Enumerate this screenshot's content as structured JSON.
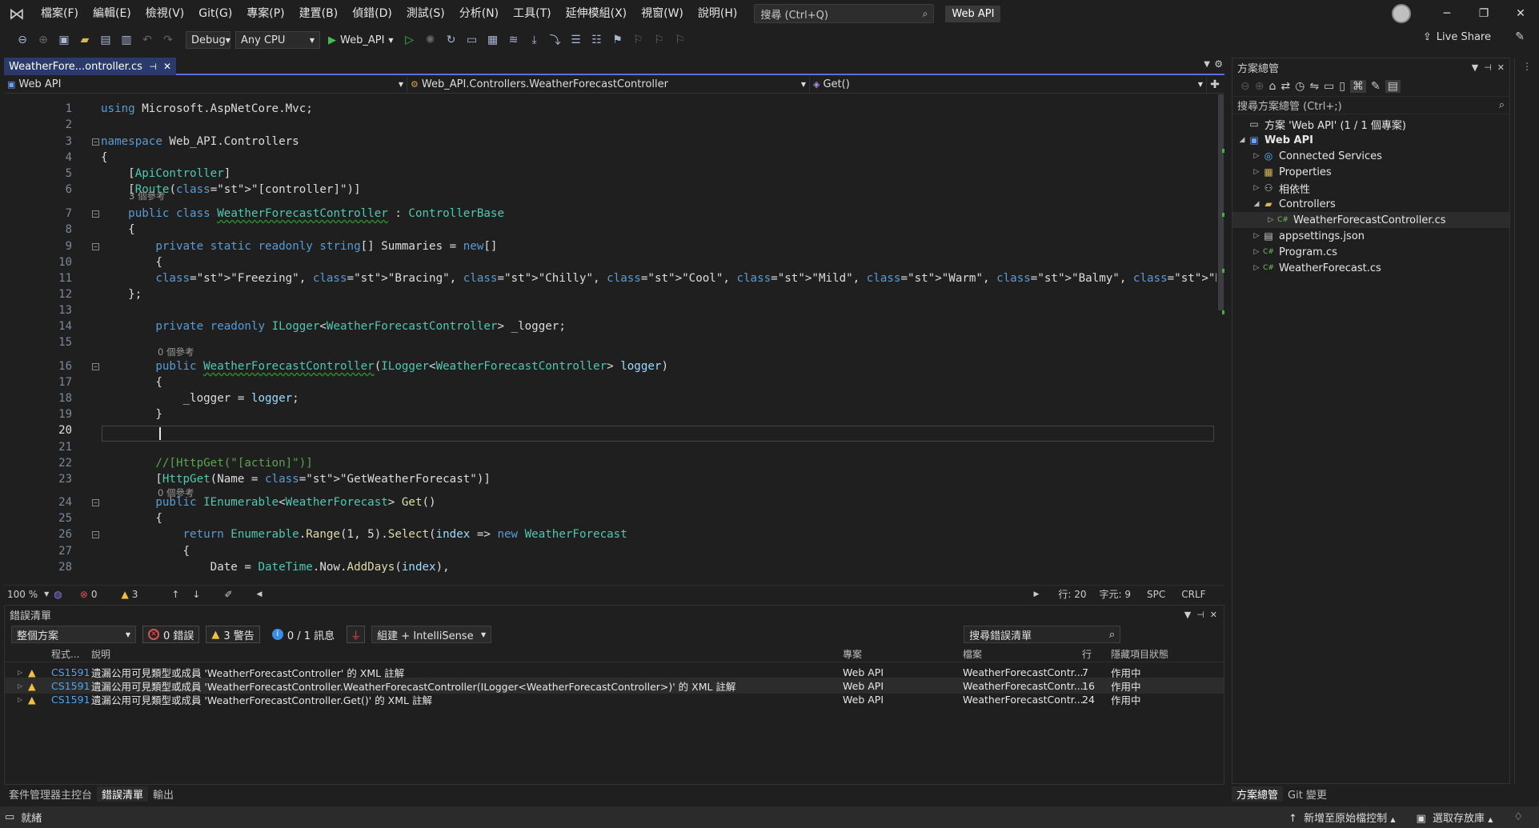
{
  "menubar": {
    "items": [
      "檔案(F)",
      "編輯(E)",
      "檢視(V)",
      "Git(G)",
      "專案(P)",
      "建置(B)",
      "偵錯(D)",
      "測試(S)",
      "分析(N)",
      "工具(T)",
      "延伸模組(X)",
      "視窗(W)",
      "說明(H)"
    ],
    "search_label": "搜尋 (Ctrl+Q)",
    "solution_name": "Web API"
  },
  "toolbar": {
    "config": "Debug",
    "platform": "Any CPU",
    "run_target": "Web_API",
    "live_share": "Live Share"
  },
  "editor": {
    "tab_title": "WeatherFore...ontroller.cs",
    "nav_project": "Web API",
    "nav_class": "Web_API.Controllers.WeatherForecastController",
    "nav_member": "Get()",
    "lines": [
      {
        "n": "1",
        "text": "using Microsoft.AspNetCore.Mvc;"
      },
      {
        "n": "2",
        "text": ""
      },
      {
        "n": "3",
        "text": "namespace Web_API.Controllers"
      },
      {
        "n": "4",
        "text": "{"
      },
      {
        "n": "5",
        "text": "    [ApiController]"
      },
      {
        "n": "6",
        "text": "    [Route(\"[controller]\")]"
      },
      {
        "n": "7",
        "text": "    public class WeatherForecastController : ControllerBase"
      },
      {
        "n": "8",
        "text": "    {"
      },
      {
        "n": "9",
        "text": "        private static readonly string[] Summaries = new[]"
      },
      {
        "n": "10",
        "text": "        {"
      },
      {
        "n": "11",
        "text": "        \"Freezing\", \"Bracing\", \"Chilly\", \"Cool\", \"Mild\", \"Warm\", \"Balmy\", \"Hot\", \"Sweltering\", \"Scorching\""
      },
      {
        "n": "12",
        "text": "    };"
      },
      {
        "n": "13",
        "text": ""
      },
      {
        "n": "14",
        "text": "        private readonly ILogger<WeatherForecastController> _logger;"
      },
      {
        "n": "15",
        "text": ""
      },
      {
        "n": "16",
        "text": "        public WeatherForecastController(ILogger<WeatherForecastController> logger)"
      },
      {
        "n": "17",
        "text": "        {"
      },
      {
        "n": "18",
        "text": "            _logger = logger;"
      },
      {
        "n": "19",
        "text": "        }"
      },
      {
        "n": "20",
        "text": ""
      },
      {
        "n": "21",
        "text": ""
      },
      {
        "n": "22",
        "text": "        //[HttpGet(\"[action]\")]"
      },
      {
        "n": "23",
        "text": "        [HttpGet(Name = \"GetWeatherForecast\")]"
      },
      {
        "n": "24",
        "text": "        public IEnumerable<WeatherForecast> Get()"
      },
      {
        "n": "25",
        "text": "        {"
      },
      {
        "n": "26",
        "text": "            return Enumerable.Range(1, 5).Select(index => new WeatherForecast"
      },
      {
        "n": "27",
        "text": "            {"
      },
      {
        "n": "28",
        "text": "                Date = DateTime.Now.AddDays(index),"
      }
    ],
    "hints": {
      "class_refs": "3 個參考",
      "ctor_refs": "0 個參考",
      "get_refs": "0 個參考"
    },
    "zoom": "100 %",
    "errors_count": "0",
    "warnings_count": "3",
    "cursor_line": "行: 20",
    "cursor_char": "字元: 9",
    "whitespace": "SPC",
    "line_ending": "CRLF"
  },
  "error_list": {
    "title": "錯誤清單",
    "scope": "整個方案",
    "errors_btn": "0 錯誤",
    "warnings_btn": "3 警告",
    "messages_btn": "0 / 1 訊息",
    "source": "組建 + IntelliSense",
    "search_placeholder": "搜尋錯誤清單",
    "columns": {
      "code": "程式...",
      "desc": "說明",
      "project": "專案",
      "file": "檔案",
      "line": "行",
      "suppression": "隱藏項目狀態"
    },
    "rows": [
      {
        "code": "CS1591",
        "desc": "遺漏公用可見類型或成員 'WeatherForecastController' 的 XML 註解",
        "project": "Web API",
        "file": "WeatherForecastContr...",
        "line": "7",
        "state": "作用中"
      },
      {
        "code": "CS1591",
        "desc": "遺漏公用可見類型或成員 'WeatherForecastController.WeatherForecastController(ILogger<WeatherForecastController>)' 的 XML 註解",
        "project": "Web API",
        "file": "WeatherForecastContr...",
        "line": "16",
        "state": "作用中"
      },
      {
        "code": "CS1591",
        "desc": "遺漏公用可見類型或成員 'WeatherForecastController.Get()' 的 XML 註解",
        "project": "Web API",
        "file": "WeatherForecastContr...",
        "line": "24",
        "state": "作用中"
      }
    ]
  },
  "bottom_tabs": [
    "套件管理器主控台",
    "錯誤清單",
    "輸出"
  ],
  "solution_explorer": {
    "title": "方案總管",
    "search_label": "搜尋方案總管 (Ctrl+;)",
    "items": [
      {
        "label": "方案 'Web API' (1 / 1 個專案)"
      },
      {
        "label": "Web API"
      },
      {
        "label": "Connected Services"
      },
      {
        "label": "Properties"
      },
      {
        "label": "相依性"
      },
      {
        "label": "Controllers"
      },
      {
        "label": "WeatherForecastController.cs"
      },
      {
        "label": "appsettings.json"
      },
      {
        "label": "Program.cs"
      },
      {
        "label": "WeatherForecast.cs"
      }
    ],
    "bottom_tabs": [
      "方案總管",
      "Git 變更"
    ]
  },
  "statusbar": {
    "ready": "就緒",
    "add_source": "新增至原始檔控制",
    "select_repo": "選取存放庫"
  },
  "colors": {
    "accent": "#5a72e0",
    "keyword": "#569cd6",
    "type": "#4ec9b0",
    "string": "#d69d85",
    "comment": "#57a64a",
    "warning": "#f0c040",
    "error": "#e05050"
  }
}
